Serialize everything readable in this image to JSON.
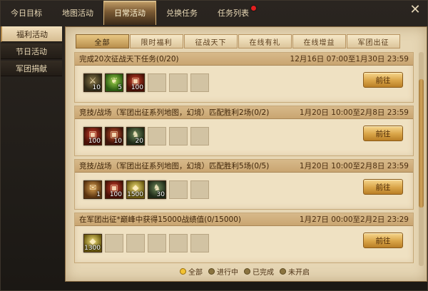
{
  "top_tabs": [
    {
      "label": "今日目标",
      "active": false,
      "badge": false
    },
    {
      "label": "地图活动",
      "active": false,
      "badge": false
    },
    {
      "label": "日常活动",
      "active": true,
      "badge": false
    },
    {
      "label": "兑换任务",
      "active": false,
      "badge": false
    },
    {
      "label": "任务列表",
      "active": false,
      "badge": true
    }
  ],
  "close_icon": "✕",
  "sidebar": [
    {
      "label": "福利活动",
      "active": true
    },
    {
      "label": "节日活动",
      "active": false
    },
    {
      "label": "军团捐献",
      "active": false
    }
  ],
  "filter_tabs": [
    {
      "label": "全部",
      "active": true
    },
    {
      "label": "限时福利",
      "active": false
    },
    {
      "label": "征战天下",
      "active": false
    },
    {
      "label": "在线有礼",
      "active": false
    },
    {
      "label": "在线增益",
      "active": false
    },
    {
      "label": "军团出征",
      "active": false
    }
  ],
  "tasks": [
    {
      "title": "完成20次征战天下任务(0/20)",
      "time": "12月16日 07:00至1月30日 23:59",
      "button": "前往",
      "rewards": [
        {
          "icon": "weapon-icon",
          "count": "10",
          "colors": [
            "#8c7a4a",
            "#2f2a18"
          ]
        },
        {
          "icon": "herb-icon",
          "count": "5",
          "colors": [
            "#9bd04a",
            "#2b5a12"
          ]
        },
        {
          "icon": "chest-icon",
          "count": "100",
          "colors": [
            "#d0402a",
            "#4a1208"
          ]
        }
      ],
      "empty_slots": 3
    },
    {
      "title": "竞技/战场（军团出征系列地图，幻境）匹配胜利2场(0/2)",
      "time": "1月20日 10:00至2月8日 23:59",
      "button": "前往",
      "rewards": [
        {
          "icon": "chest-icon",
          "count": "100",
          "colors": [
            "#d0402a",
            "#4a1208"
          ]
        },
        {
          "icon": "chest-icon",
          "count": "10",
          "colors": [
            "#c8502a",
            "#3e140a"
          ]
        },
        {
          "icon": "horse-icon",
          "count": "20",
          "colors": [
            "#6f8a5a",
            "#1f2a18"
          ]
        }
      ],
      "empty_slots": 3
    },
    {
      "title": "竞技/战场（军团出征系列地图，幻境）匹配胜利5场(0/5)",
      "time": "1月20日 10:00至2月8日 23:59",
      "button": "前往",
      "rewards": [
        {
          "icon": "scroll-icon",
          "count": "1",
          "colors": [
            "#d8a050",
            "#5a3410"
          ]
        },
        {
          "icon": "chest-icon",
          "count": "100",
          "colors": [
            "#d0402a",
            "#4a1208"
          ]
        },
        {
          "icon": "gold-icon",
          "count": "1500",
          "colors": [
            "#f5e27a",
            "#6a5a10"
          ]
        },
        {
          "icon": "horse-icon",
          "count": "30",
          "colors": [
            "#6f8a5a",
            "#1f2a18"
          ]
        }
      ],
      "empty_slots": 2
    },
    {
      "title": "在军团出征*巅峰中获得15000战绩值(0/15000)",
      "time": "1月27日 00:00至2月2日 23:29",
      "button": "前往",
      "rewards": [
        {
          "icon": "gold-icon",
          "count": "1300",
          "colors": [
            "#f5e27a",
            "#6a5a10"
          ]
        }
      ],
      "empty_slots": 5
    }
  ],
  "legend": [
    {
      "label": "全部",
      "active": true
    },
    {
      "label": "进行中",
      "active": false
    },
    {
      "label": "已完成",
      "active": false
    },
    {
      "label": "未开启",
      "active": false
    }
  ]
}
